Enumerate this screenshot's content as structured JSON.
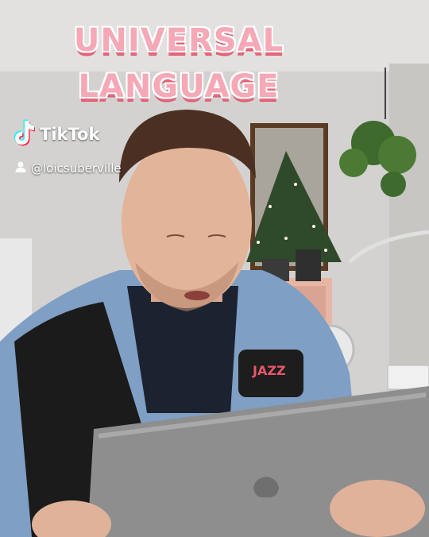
{
  "overlay": {
    "title_line_1": "UNIVERSAL",
    "title_line_2": "LANGUAGE",
    "platform_label": "TikTok",
    "username": "@loicsuberville"
  },
  "icons": {
    "platform": "tiktok-logo-icon",
    "user": "user-icon"
  },
  "colors": {
    "title_fill": "#f6a8b6",
    "title_shadow": "#e5667a",
    "overlay_text": "#ffffff"
  }
}
